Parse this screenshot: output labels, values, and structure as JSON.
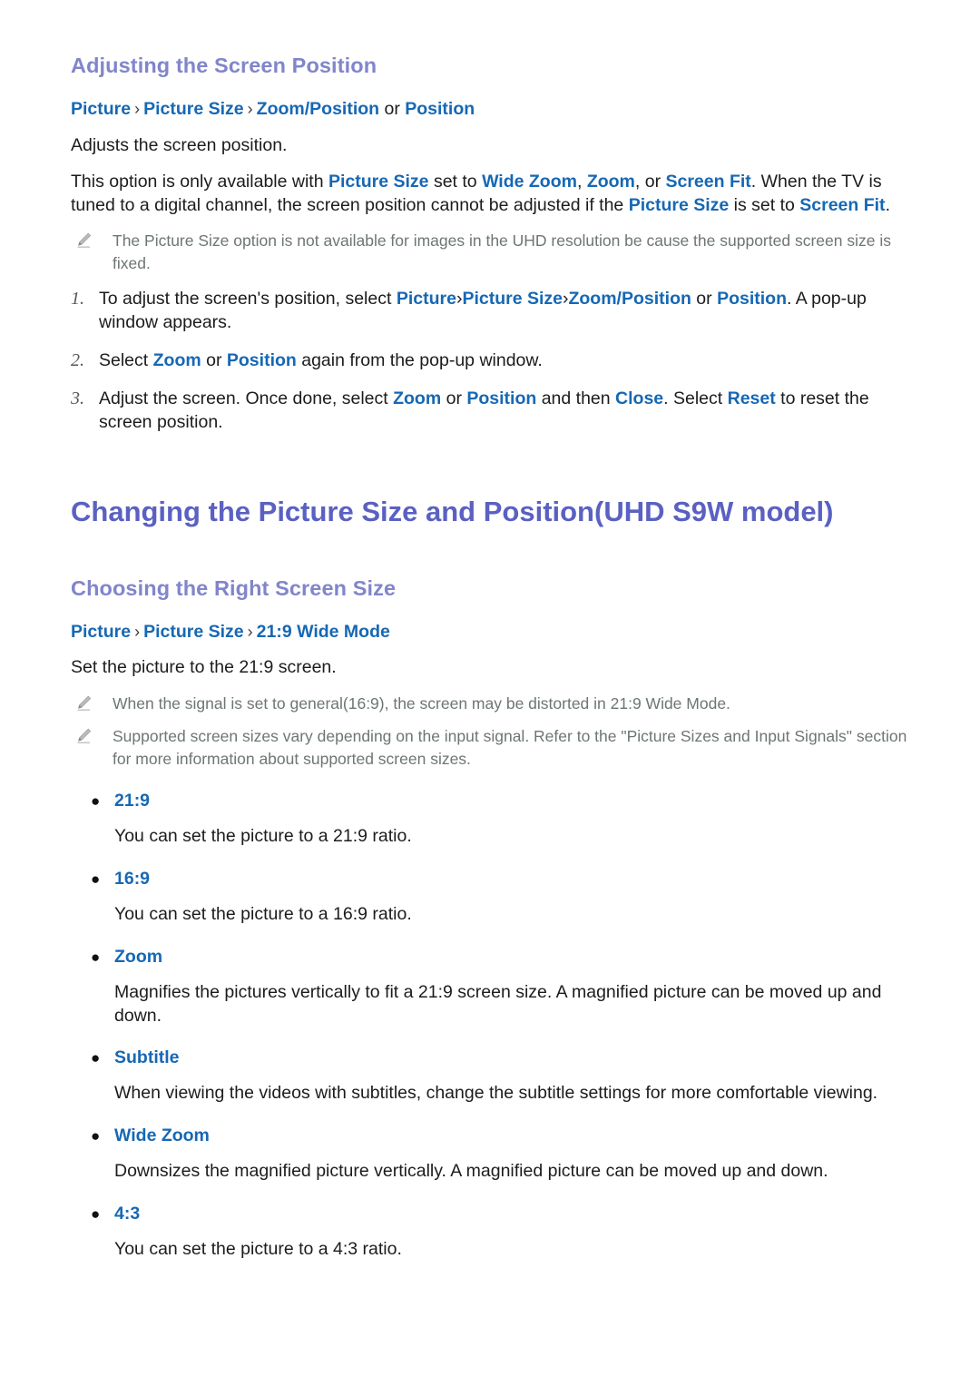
{
  "page": {
    "background_color": "#ffffff",
    "text_color": "#1c1c1c",
    "link_color": "#1668b4",
    "heading_main_color": "#5a61c2",
    "heading_sub_color": "#8185ca",
    "note_color": "#6d7674",
    "number_color": "#55585a"
  },
  "section1": {
    "heading": "Adjusting the Screen Position",
    "breadcrumb": {
      "part1": "Picture",
      "sep1": "›",
      "part2": "Picture Size",
      "sep2": "›",
      "part3": "Zoom/Position",
      "joiner": "or",
      "part4": "Position"
    },
    "intro": "Adjusts the screen position.",
    "paragraph": {
      "t1": "This option is only available with ",
      "k1": "Picture Size",
      "t2": " set to ",
      "k2": "Wide Zoom",
      "t3": ", ",
      "k3": "Zoom",
      "t4": ", or ",
      "k4": "Screen Fit",
      "t5": ". When the TV is tuned to a digital channel, the screen position cannot be adjusted if the ",
      "k5": "Picture Size",
      "t6": " is set to ",
      "k6": "Screen Fit",
      "t7": "."
    },
    "note": "The Picture Size option is not available for images in the UHD resolution be cause the supported screen size is fixed.",
    "steps": [
      {
        "num": "1.",
        "t1": "To adjust the screen's position, select ",
        "k1": "Picture",
        "s1": "›",
        "k2": "Picture Size",
        "s2": "›",
        "k3": "Zoom/Position",
        "t2": " or ",
        "k4": "Position",
        "t3": ". A pop-up window appears."
      },
      {
        "num": "2.",
        "t1": "Select ",
        "k1": "Zoom",
        "t2": " or ",
        "k2": "Position",
        "t3": " again from the pop-up window."
      },
      {
        "num": "3.",
        "t1": "Adjust the screen. Once done, select ",
        "k1": "Zoom",
        "t2": " or ",
        "k2": "Position",
        "t3": " and then ",
        "k3": "Close",
        "t4": ". Select ",
        "k4": "Reset",
        "t5": " to reset the screen position."
      }
    ]
  },
  "section2": {
    "heading": "Changing the Picture Size and Position(UHD S9W model)",
    "subheading": "Choosing the Right Screen Size",
    "breadcrumb": {
      "part1": "Picture",
      "sep1": "›",
      "part2": "Picture Size",
      "sep2": "›",
      "part3": "21:9 Wide Mode"
    },
    "intro": "Set the picture to the 21:9 screen.",
    "notes": [
      "When the signal is set to general(16:9), the screen may be distorted in 21:9 Wide Mode.",
      "Supported screen sizes vary depending on the input signal. Refer to the \"Picture Sizes and Input Signals\" section for more information about supported screen sizes."
    ],
    "options": [
      {
        "label": "21:9",
        "description": "You can set the picture to a 21:9 ratio."
      },
      {
        "label": "16:9",
        "description": "You can set the picture to a 16:9 ratio."
      },
      {
        "label": "Zoom",
        "description": "Magnifies the pictures vertically to fit a 21:9 screen size. A magnified picture can be moved up and down."
      },
      {
        "label": "Subtitle",
        "description": "When viewing the videos with subtitles, change the subtitle settings for more comfortable viewing."
      },
      {
        "label": "Wide Zoom",
        "description": "Downsizes the magnified picture vertically. A magnified picture can be moved up and down."
      },
      {
        "label": "4:3",
        "description": "You can set the picture to a 4:3 ratio."
      }
    ]
  },
  "icons": {
    "bullet": "●",
    "pencil": "pencil-note-icon"
  }
}
